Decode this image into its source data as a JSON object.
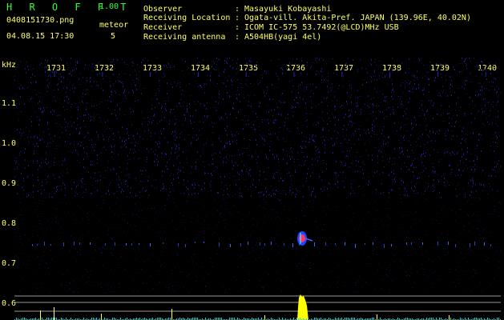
{
  "app": {
    "name": "H R O F F T",
    "version": "1.00"
  },
  "file": {
    "name": "0408151730.png",
    "datetime": "04.08.15 17:30"
  },
  "meteor": {
    "label": "meteor",
    "count": "5"
  },
  "info": [
    {
      "label": "Observer",
      "value": "Masayuki Kobayashi"
    },
    {
      "label": "Receiving Location",
      "value": "Ogata-vill. Akita-Pref. JAPAN (139.96E, 40.02N)"
    },
    {
      "label": "Receiver",
      "value": "ICOM IC-575 53.7492(@LCD)MHz USB"
    },
    {
      "label": "Receiving antenna",
      "value": "A504HB(yagi 4el)"
    }
  ],
  "axis": {
    "y_unit": "kHz",
    "minutes": [
      "1731",
      "1732",
      "1733",
      "1734",
      "1735",
      "1736",
      "1737",
      "1738",
      "1739",
      "1740"
    ],
    "y_ticks": [
      "1.1",
      "1.0",
      "0.9",
      "0.8",
      "0.7",
      "0.6"
    ]
  },
  "colors": {
    "background": "#000000",
    "text": "#ffff66",
    "logo": "#33ff33",
    "noise": "#1a1a8c",
    "carrier": "#3366ff",
    "meteor_core": "#ff3366",
    "meteor_halo": "#3366ff",
    "meteor_power": "#ffff00",
    "power_lines": "#aaaaaa"
  }
}
